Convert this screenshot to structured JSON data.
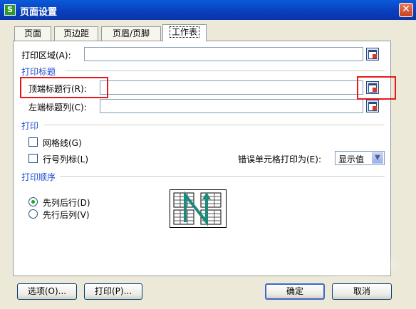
{
  "window": {
    "title": "页面设置",
    "app_icon_glyph": "S",
    "close_glyph": "✕"
  },
  "tabs": [
    {
      "label": "页面"
    },
    {
      "label": "页边距"
    },
    {
      "label": "页眉/页脚"
    },
    {
      "label": "工作表"
    }
  ],
  "print_area": {
    "label": "打印区域(A):",
    "value": ""
  },
  "print_titles": {
    "section_label": "打印标题",
    "rows_to_repeat": {
      "label": "顶端标题行(R):",
      "value": ""
    },
    "columns_to_repeat": {
      "label": "左端标题列(C):",
      "value": ""
    }
  },
  "print": {
    "section_label": "打印",
    "gridlines": {
      "label": "网格线(G)",
      "checked": false
    },
    "row_col_headings": {
      "label": "行号列标(L)",
      "checked": false
    },
    "cell_errors": {
      "label": "错误单元格打印为(E):",
      "value": "显示值"
    }
  },
  "page_order": {
    "section_label": "打印顺序",
    "down_then_over": {
      "label": "先列后行(D)",
      "selected": true
    },
    "over_then_down": {
      "label": "先行后列(V)",
      "selected": false
    }
  },
  "buttons": {
    "options": "选项(O)...",
    "print": "打印(P)...",
    "ok": "确定",
    "cancel": "取消"
  },
  "colors": {
    "titlebar": "#0a3fbf",
    "section": "#1f4fd1",
    "highlight": "#e8191b",
    "face": "#ece9d8"
  },
  "icons": {
    "range_selector": "range-select-icon",
    "dropdown": "chevron-down-icon"
  }
}
